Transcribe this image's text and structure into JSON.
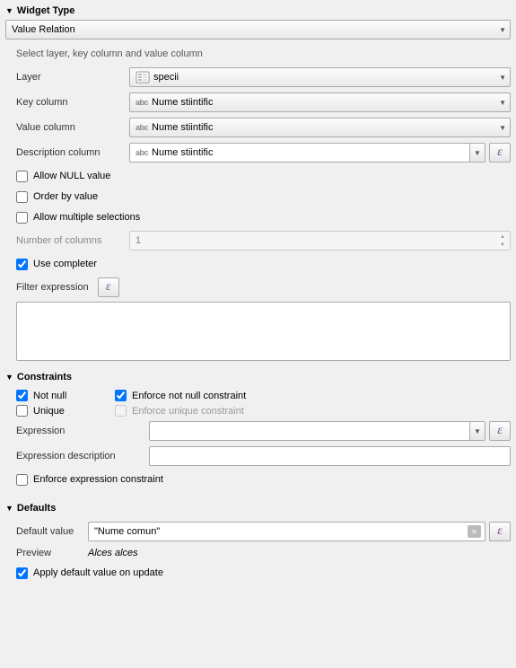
{
  "widgetType": {
    "header": "Widget Type",
    "combo": "Value Relation",
    "subtitle": "Select layer, key column and value column",
    "labels": {
      "layer": "Layer",
      "key": "Key column",
      "value": "Value column",
      "desc": "Description column",
      "numCols": "Number of columns",
      "filter": "Filter expression"
    },
    "fields": {
      "layer": "specii",
      "key": "Nume stiintific",
      "value": "Nume stiintific",
      "desc": "Nume stiintific",
      "numCols": "1"
    },
    "checks": {
      "allow_null": "Allow NULL value",
      "order_by": "Order by value",
      "multi": "Allow multiple selections",
      "completer": "Use completer"
    }
  },
  "constraints": {
    "header": "Constraints",
    "labels": {
      "notnull": "Not null",
      "enforce_nn": "Enforce not null constraint",
      "unique": "Unique",
      "enforce_un": "Enforce unique constraint",
      "expression": "Expression",
      "expr_desc": "Expression description",
      "enforce_expr": "Enforce expression constraint"
    }
  },
  "defaults": {
    "header": "Defaults",
    "labels": {
      "default": "Default value",
      "preview": "Preview",
      "apply": "Apply default value on update"
    },
    "default_value": "\"Nume comun\"",
    "preview": "Alces alces"
  }
}
